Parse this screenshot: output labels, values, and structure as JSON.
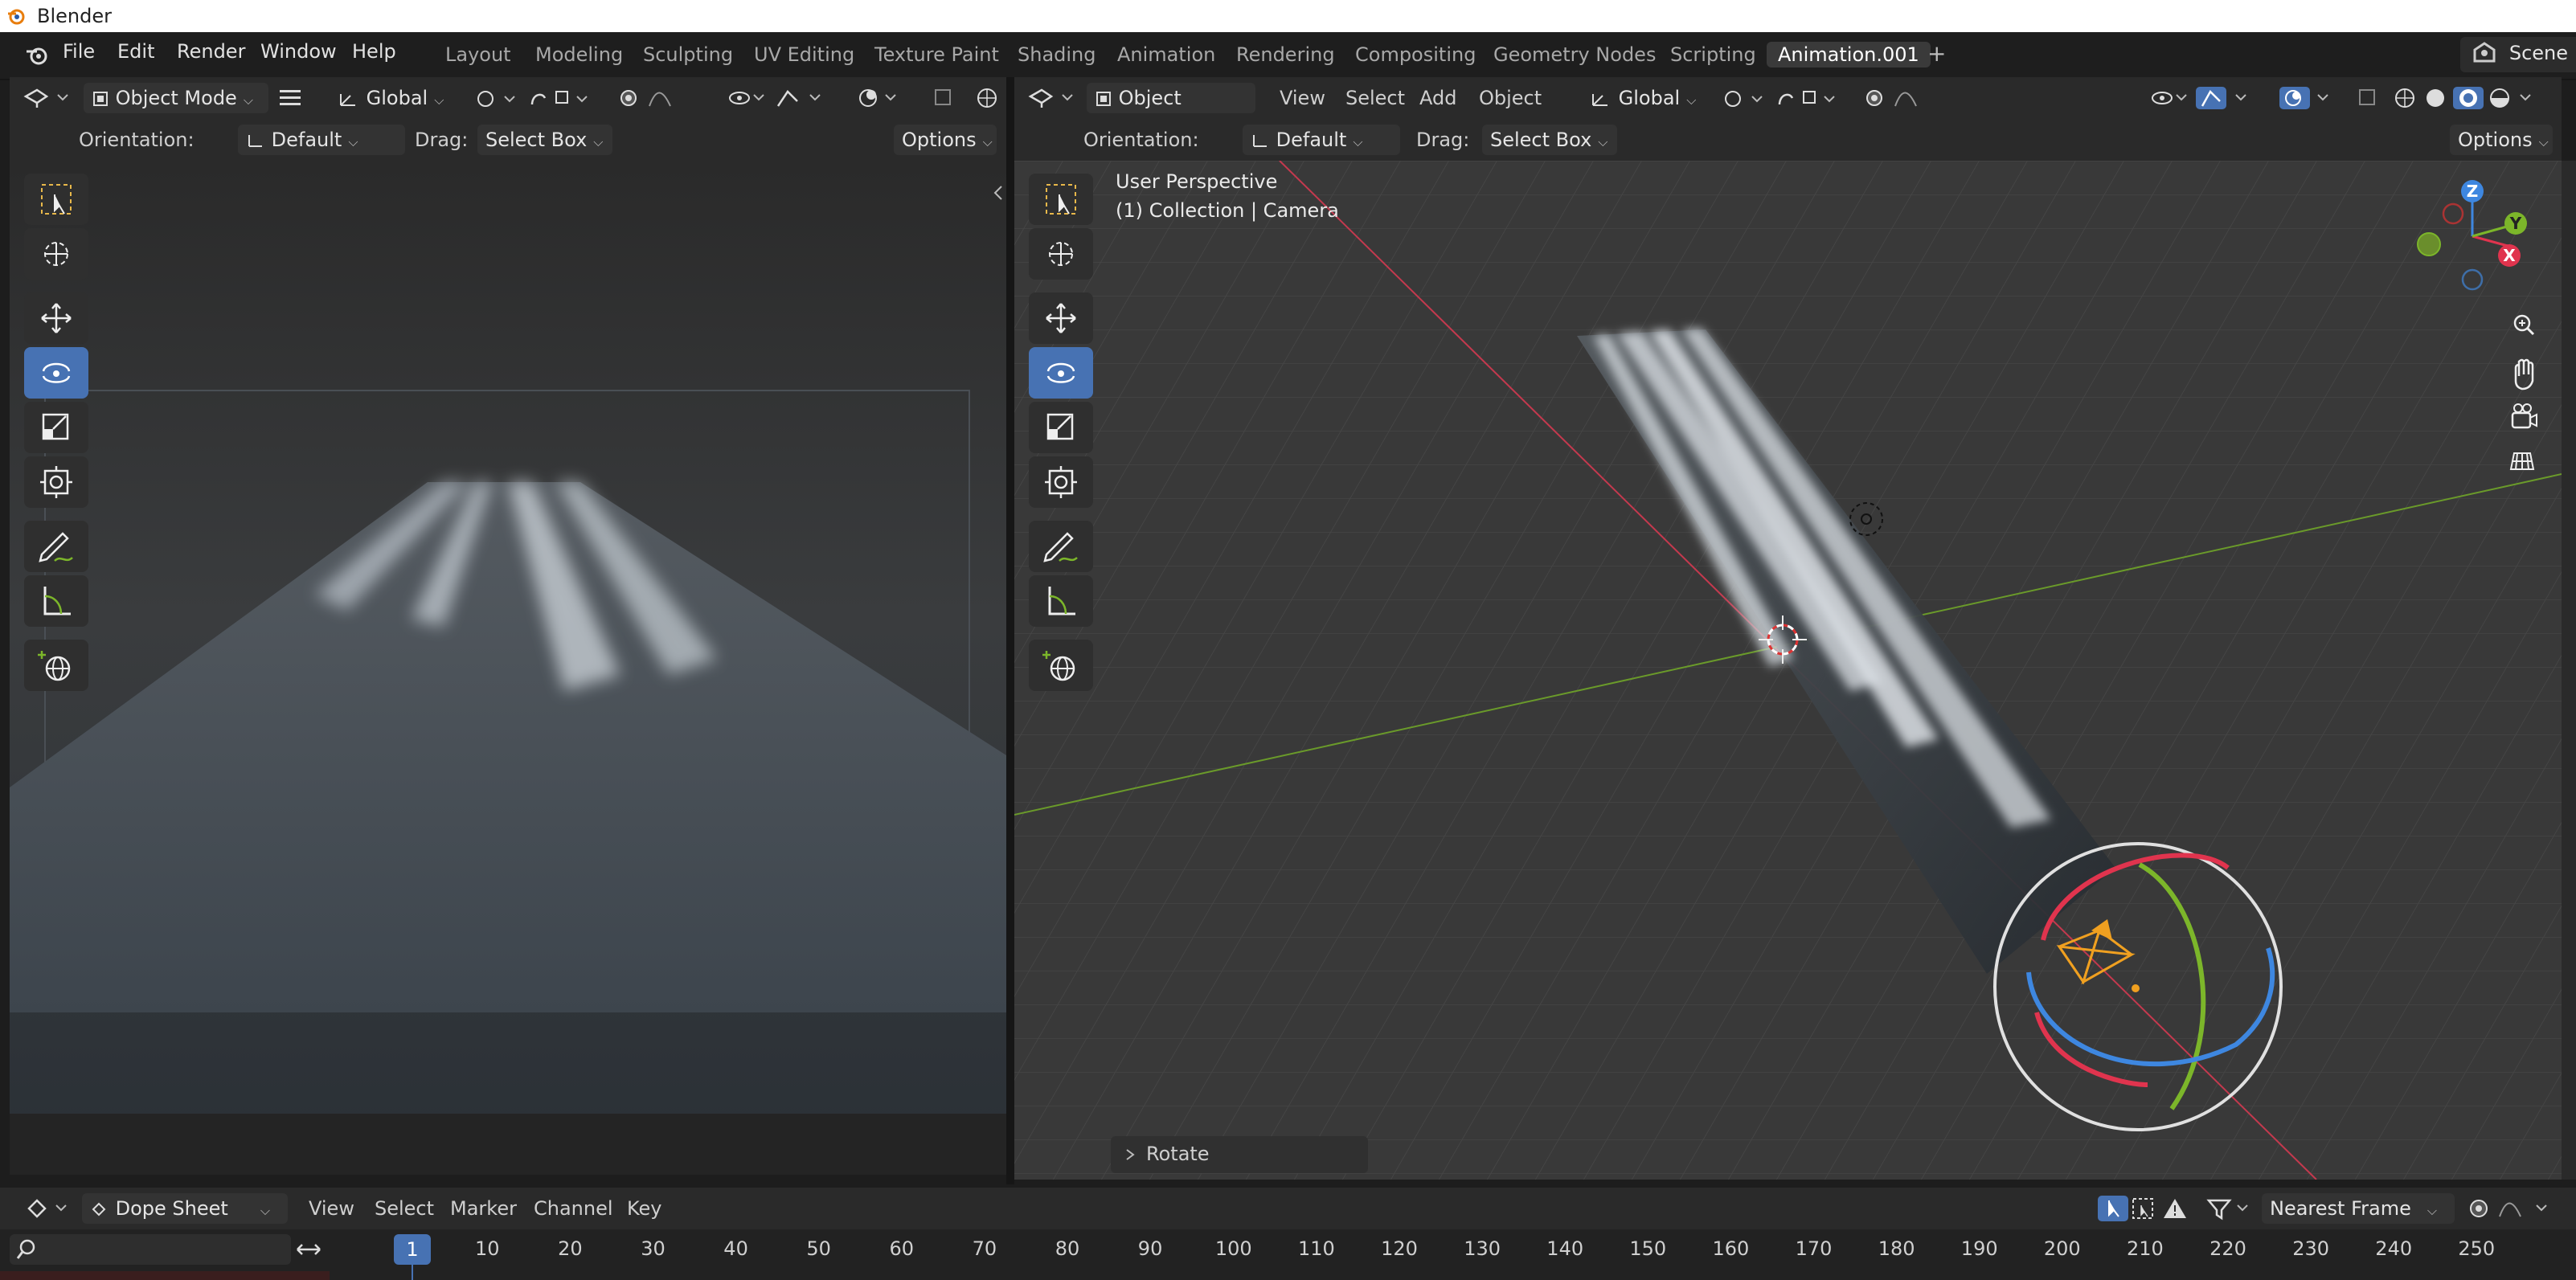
{
  "app": {
    "title": "Blender"
  },
  "menu": [
    "File",
    "Edit",
    "Render",
    "Window",
    "Help"
  ],
  "workspaces": [
    "Layout",
    "Modeling",
    "Sculpting",
    "UV Editing",
    "Texture Paint",
    "Shading",
    "Animation",
    "Rendering",
    "Compositing",
    "Geometry Nodes",
    "Scripting",
    "Animation.001"
  ],
  "active_workspace": "Animation.001",
  "scene_label": "Scene",
  "left_view": {
    "mode": "Object Mode",
    "transform_space": "Global",
    "orientation_label": "Orientation:",
    "orientation_value": "Default",
    "drag_label": "Drag:",
    "drag_value": "Select Box",
    "options_label": "Options"
  },
  "right_view": {
    "mode": "Object Mode",
    "menus": [
      "View",
      "Select",
      "Add",
      "Object"
    ],
    "transform_space": "Global",
    "orientation_label": "Orientation:",
    "orientation_value": "Default",
    "drag_label": "Drag:",
    "drag_value": "Select Box",
    "options_label": "Options",
    "perspective": "User Perspective",
    "collection": "(1) Collection | Camera",
    "last_op": "Rotate",
    "gizmo": {
      "z": "Z",
      "y": "Y",
      "x": "X"
    }
  },
  "timeline": {
    "editor": "Dope Sheet",
    "menus": [
      "View",
      "Select",
      "Marker",
      "Channel",
      "Key"
    ],
    "snap": "Nearest Frame",
    "current_frame": "1",
    "ticks": [
      "10",
      "20",
      "30",
      "40",
      "50",
      "60",
      "70",
      "80",
      "90",
      "100",
      "110",
      "120",
      "130",
      "140",
      "150",
      "160",
      "170",
      "180",
      "190",
      "200",
      "210",
      "220",
      "230",
      "240",
      "250"
    ]
  },
  "colors": {
    "accent": "#4772b3",
    "x_axis": "#e0344e",
    "y_axis": "#7cb62a",
    "z_axis": "#3e87e0"
  }
}
